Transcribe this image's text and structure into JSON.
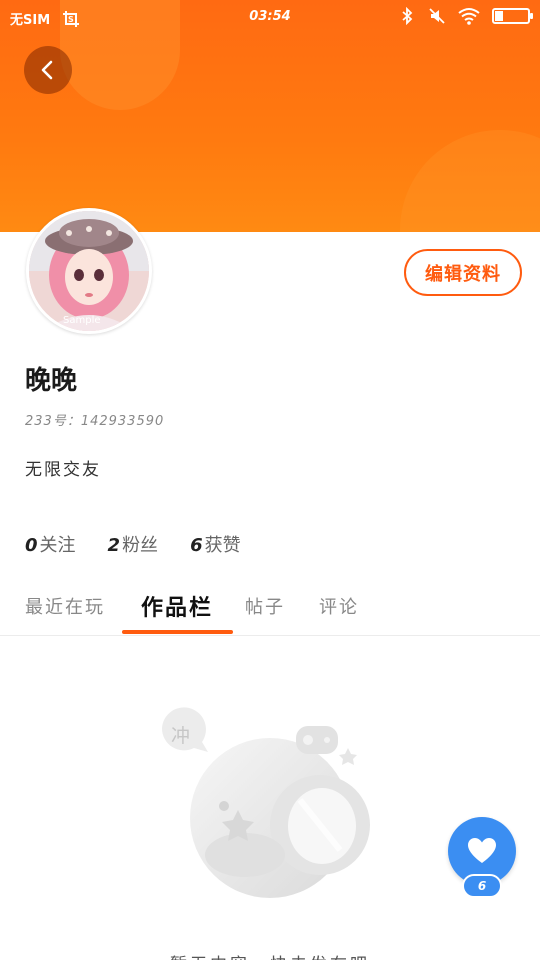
{
  "status_bar": {
    "carrier": "无SIM",
    "time": "03:54",
    "icons": [
      "screenshot-icon",
      "bluetooth-icon",
      "mute-icon",
      "wifi-icon",
      "battery-icon"
    ]
  },
  "header": {
    "back_icon": "chevron-left-icon",
    "edit_label": "编辑资料",
    "accent_color": "#ff5b0f"
  },
  "profile": {
    "avatar_watermark": "Sample",
    "name": "晚晚",
    "id_label": "233号：",
    "id_value": "142933590",
    "bio": "无限交友"
  },
  "stats": [
    {
      "value": "0",
      "label": "关注"
    },
    {
      "value": "2",
      "label": "粉丝"
    },
    {
      "value": "6",
      "label": "获赞"
    }
  ],
  "tabs": [
    {
      "label": "最近在玩",
      "active": false
    },
    {
      "label": "作品栏",
      "active": true
    },
    {
      "label": "帖子",
      "active": false
    },
    {
      "label": "评论",
      "active": false
    }
  ],
  "empty": {
    "bubble_text": "冲",
    "message": "暂无内容，快去发布吧"
  },
  "fab": {
    "icon": "heart-icon",
    "count": "6",
    "color": "#3b8ef2"
  }
}
